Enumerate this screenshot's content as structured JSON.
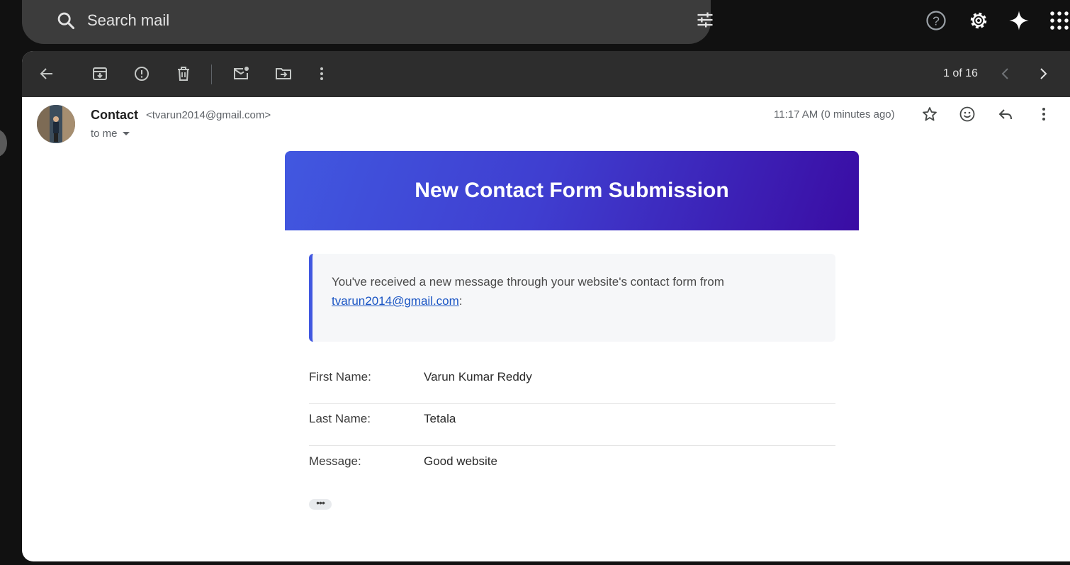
{
  "search": {
    "placeholder": "Search mail"
  },
  "top_right_icons": [
    "help-icon",
    "settings-icon",
    "gemini-sparkle-icon",
    "apps-grid-icon"
  ],
  "toolbar": {
    "icons": [
      "back-arrow-icon",
      "archive-icon",
      "report-spam-icon",
      "delete-icon",
      "mark-unread-icon",
      "move-to-icon",
      "more-vert-icon"
    ],
    "pagination": "1 of 16"
  },
  "email": {
    "sender_name": "Contact",
    "sender_email": "<tvarun2014@gmail.com>",
    "recipient": "to me",
    "time": "11:17 AM (0 minutes ago)",
    "header_icons": [
      "star-icon",
      "emoji-reaction-icon",
      "reply-icon",
      "more-vert-icon"
    ],
    "body": {
      "banner_title": "New Contact Form Submission",
      "notice_text": "You've received a new message through your website's contact form from",
      "notice_link": "tvarun2014@gmail.com",
      "notice_suffix": ":",
      "fields": [
        {
          "label": "First Name:",
          "value": "Varun Kumar Reddy"
        },
        {
          "label": "Last Name:",
          "value": "Tetala"
        },
        {
          "label": "Message:",
          "value": "Good website"
        }
      ],
      "trimmed_content": "•••"
    }
  },
  "colors": {
    "background": "#111111",
    "toolbar": "#2d2d2d",
    "banner_start": "#4158e0",
    "banner_end": "#3a0ca3",
    "link": "#1a55c4"
  }
}
